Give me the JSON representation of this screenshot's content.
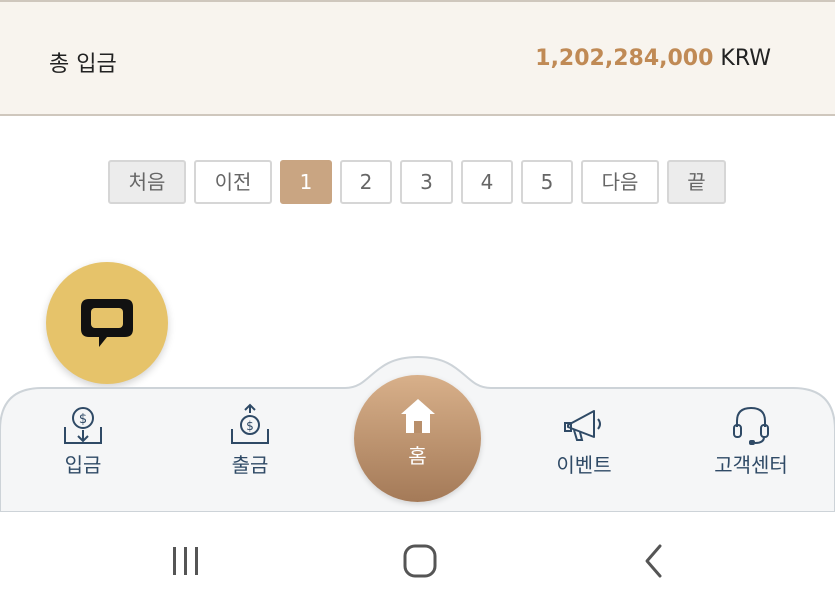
{
  "summary": {
    "label": "총 입금",
    "amount": "1,202,284,000",
    "currency": "KRW"
  },
  "pagination": {
    "first": "처음",
    "prev": "이전",
    "pages": [
      "1",
      "2",
      "3",
      "4",
      "5"
    ],
    "next": "다음",
    "last": "끝",
    "current_page": 1
  },
  "chat": {
    "icon": "chat-bubble-icon"
  },
  "bottom_nav": {
    "items": [
      {
        "label": "입금",
        "icon": "deposit-icon"
      },
      {
        "label": "출금",
        "icon": "withdraw-icon"
      },
      {
        "label": "홈",
        "icon": "home-icon"
      },
      {
        "label": "이벤트",
        "icon": "megaphone-icon"
      },
      {
        "label": "고객센터",
        "icon": "headset-icon"
      }
    ]
  },
  "system_nav": {
    "icons": [
      "recent-apps-icon",
      "home-icon",
      "back-icon"
    ]
  },
  "colors": {
    "accent": "#c08a55",
    "summary_bg": "#f8f4ee",
    "active_page": "#c9a582",
    "fab": "#e6c36a",
    "nav_text": "#2f4a66"
  }
}
